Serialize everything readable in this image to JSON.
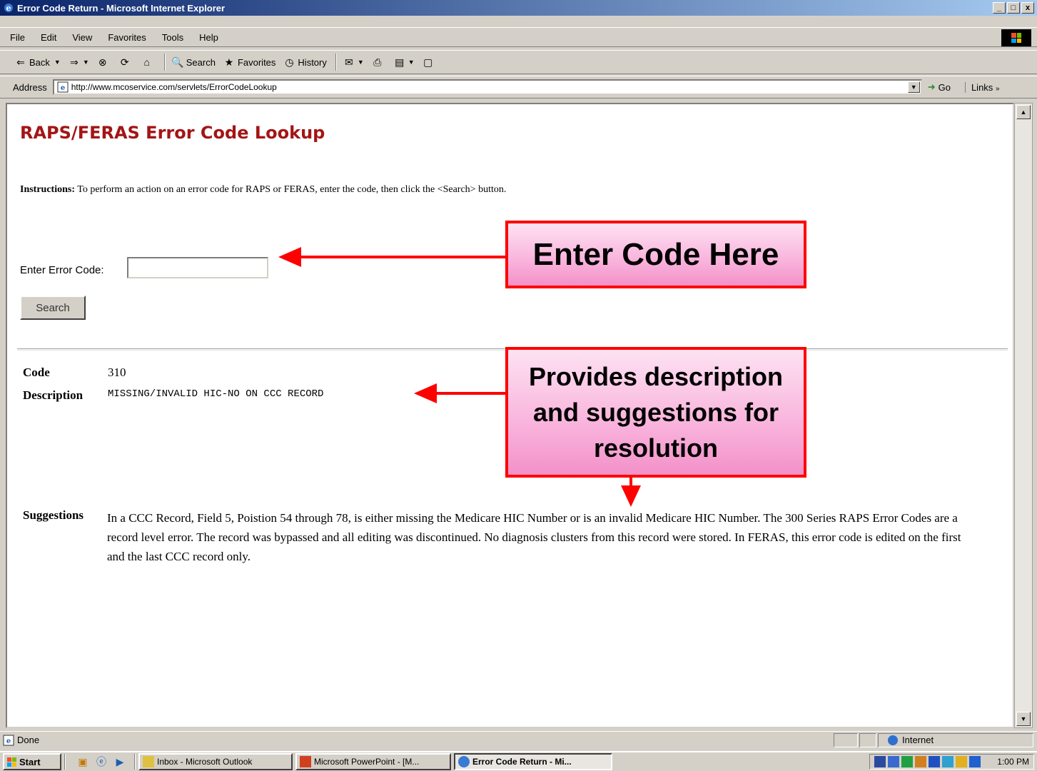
{
  "window": {
    "title": "Error Code Return - Microsoft Internet Explorer",
    "min": "_",
    "max": "□",
    "close": "x"
  },
  "menu": [
    "File",
    "Edit",
    "View",
    "Favorites",
    "Tools",
    "Help"
  ],
  "toolbar": {
    "back": "Back",
    "search": "Search",
    "favorites": "Favorites",
    "history": "History"
  },
  "address": {
    "label": "Address",
    "url": "http://www.mcoservice.com/servlets/ErrorCodeLookup",
    "go": "Go",
    "links": "Links"
  },
  "page": {
    "title": "RAPS/FERAS Error Code Lookup",
    "instructions_label": "Instructions:",
    "instructions_text": " To perform an action on an error code for RAPS or FERAS, enter the code, then click the <Search> button.",
    "enter_label": "Enter Error Code:",
    "code_value": "",
    "search_button": "Search"
  },
  "result": {
    "code_label": "Code",
    "code_value": "310",
    "description_label": "Description",
    "description_value": "MISSING/INVALID HIC-NO ON CCC RECORD",
    "suggestions_label": "Suggestions",
    "suggestions_value": "In a CCC Record, Field 5, Poistion 54 through 78, is either missing the Medicare HIC Number or is an invalid Medicare HIC Number. The 300 Series RAPS Error Codes are a record level error. The record was bypassed and all editing was discontinued. No diagnosis clusters from this record were stored. In FERAS, this error code is edited on the first and the last CCC record only."
  },
  "callouts": {
    "enter_code": "Enter Code Here",
    "provides": "Provides description and suggestions for resolution"
  },
  "status": {
    "text": "Done",
    "zone": "Internet"
  },
  "taskbar": {
    "start": "Start",
    "tasks": [
      "Inbox - Microsoft Outlook",
      "Microsoft PowerPoint - [M...",
      "Error Code Return - Mi..."
    ],
    "clock": "1:00 PM"
  },
  "colors": {
    "title_red": "#a31515",
    "callout_border": "#ff0000",
    "callout_fill": "#f9b3dc"
  }
}
